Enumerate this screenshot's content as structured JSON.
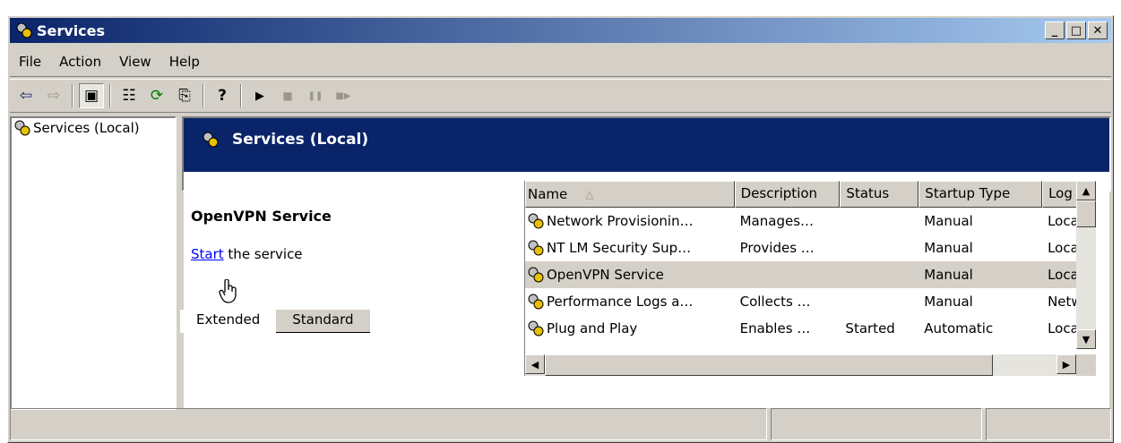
{
  "window": {
    "title": "Services"
  },
  "menu": [
    "File",
    "Action",
    "View",
    "Help"
  ],
  "toolbar": {
    "buttons": [
      {
        "name": "back-icon",
        "glyph": "⇦"
      },
      {
        "name": "forward-icon",
        "glyph": "⇨"
      },
      {
        "name": "show-hide-console-tree-icon",
        "glyph": "▣"
      },
      {
        "name": "properties-icon",
        "glyph": "☷"
      },
      {
        "name": "refresh-icon",
        "glyph": "⟳"
      },
      {
        "name": "export-list-icon",
        "glyph": "⎘"
      },
      {
        "name": "help-icon",
        "glyph": "?"
      },
      {
        "name": "start-service-icon",
        "glyph": "▶"
      },
      {
        "name": "stop-service-icon",
        "glyph": "■"
      },
      {
        "name": "pause-service-icon",
        "glyph": "❚❚"
      },
      {
        "name": "restart-service-icon",
        "glyph": "■▶"
      }
    ]
  },
  "tree": {
    "root_label": "Services (Local)"
  },
  "banner": {
    "title": "Services (Local)"
  },
  "detail": {
    "service_name": "OpenVPN Service",
    "action_link": "Start",
    "action_suffix": " the service"
  },
  "list": {
    "columns": [
      "Name",
      "Description",
      "Status",
      "Startup Type",
      "Log ("
    ],
    "rows": [
      {
        "name": "Network Provisionin…",
        "description": "Manages…",
        "status": "",
        "startup": "Manual",
        "logon": "Local"
      },
      {
        "name": "NT LM Security Sup…",
        "description": "Provides …",
        "status": "",
        "startup": "Manual",
        "logon": "Local"
      },
      {
        "name": "OpenVPN Service",
        "description": "",
        "status": "",
        "startup": "Manual",
        "logon": "Local"
      },
      {
        "name": "Performance Logs a…",
        "description": "Collects …",
        "status": "",
        "startup": "Manual",
        "logon": "Netw"
      },
      {
        "name": "Plug and Play",
        "description": "Enables …",
        "status": "Started",
        "startup": "Automatic",
        "logon": "Local"
      }
    ],
    "selected_row_index": 2
  },
  "tabs": [
    "Extended",
    "Standard"
  ],
  "active_tab": 0,
  "colors": {
    "titlebar": "#0a246a",
    "face": "#d4d0c8",
    "link": "#0000ff"
  }
}
